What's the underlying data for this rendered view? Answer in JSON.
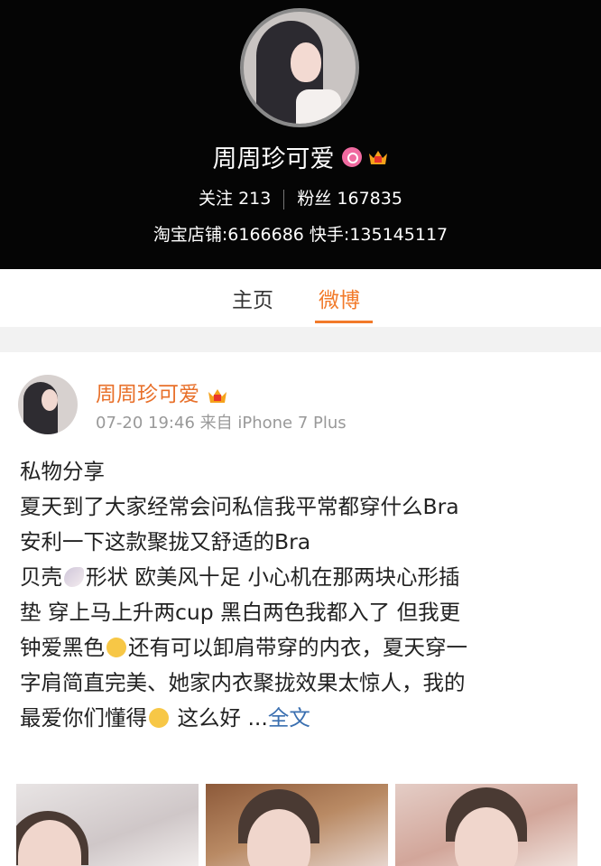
{
  "profile": {
    "name": "周周珍可爱",
    "following_label": "关注",
    "following_count": "213",
    "followers_label": "粉丝",
    "followers_count": "167835",
    "shop_line": "淘宝店铺:6166686 快手:135145117"
  },
  "tabs": [
    {
      "label": "主页",
      "active": false
    },
    {
      "label": "微博",
      "active": true
    }
  ],
  "post": {
    "author": "周周珍可爱",
    "meta": "07-20 19:46 来自 iPhone 7 Plus",
    "lines": {
      "l1": "私物分享",
      "l2": "夏天到了大家经常会问私信我平常都穿什么Bra",
      "l3": "安利一下这款聚拢又舒适的Bra",
      "l4a": "贝壳",
      "l4b": "形状 欧美风十足 小心机在那两块心形插",
      "l5": "垫 穿上马上升两cup 黑白两色我都入了 但我更",
      "l6a": "钟爱黑色",
      "l6b": "还有可以卸肩带穿的内衣，夏天穿一",
      "l7": "字肩简直完美、她家内衣聚拢效果太惊人，我的",
      "l8a": "最爱你们懂得",
      "l8b": " 这么好 ...",
      "more": "全文"
    }
  },
  "colors": {
    "accent": "#f27a2a",
    "author": "#e8702a",
    "link": "#3a6fb0",
    "header_bg": "#050505"
  },
  "icons": [
    "pink-badge-icon",
    "crown-vip-icon",
    "shell-emoji-icon",
    "smirk-emoji-icon",
    "relieved-emoji-icon"
  ]
}
